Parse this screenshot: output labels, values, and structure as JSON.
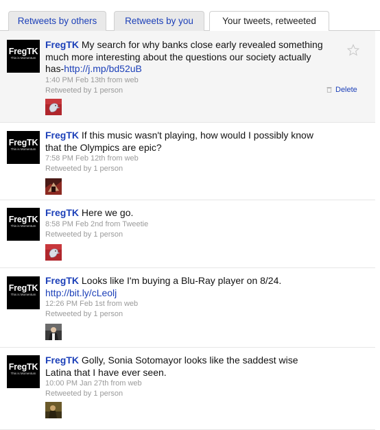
{
  "tabs": [
    {
      "label": "Retweets by others",
      "active": false
    },
    {
      "label": "Retweets by you",
      "active": false
    },
    {
      "label": "Your tweets, retweeted",
      "active": true
    }
  ],
  "avatar_logo": "FregTK",
  "avatar_tagline": "This is Momentum",
  "tweets": [
    {
      "user": "FregTK",
      "text": "My search for why banks close early revealed something much more interesting about the questions our society actually has-",
      "link": "http://j.mp/bd52uB",
      "time": "1:40 PM Feb 13th",
      "from": "from web",
      "retweeted_by": "Retweeted by 1 person",
      "delete_label": "Delete",
      "retweeter_avatar": "gray-bird-icon"
    },
    {
      "user": "FregTK",
      "text": "If this music wasn't playing, how would I possibly know that the Olympics are epic?",
      "link": "",
      "time": "7:58 PM Feb 12th",
      "from": "from web",
      "retweeted_by": "Retweeted by 1 person",
      "retweeter_avatar": "red-photo-avatar"
    },
    {
      "user": "FregTK",
      "text": "Here we go.",
      "link": "",
      "time": "8:58 PM Feb 2nd",
      "from": "from Tweetie",
      "retweeted_by": "Retweeted by 1 person",
      "retweeter_avatar": "gray-bird-icon"
    },
    {
      "user": "FregTK",
      "text": "Looks like I'm buying a Blu-Ray player on 8/24.",
      "link": "http://bit.ly/cLeolj",
      "time": "12:26 PM Feb 1st",
      "from": "from web",
      "retweeted_by": "Retweeted by 1 person",
      "retweeter_avatar": "person-photo-avatar"
    },
    {
      "user": "FregTK",
      "text": "Golly, Sonia Sotomayor looks like the saddest wise Latina that I have ever seen.",
      "link": "",
      "time": "10:00 PM Jan 27th",
      "from": "from web",
      "retweeted_by": "Retweeted by 1 person",
      "retweeter_avatar": "dark-photo-avatar"
    }
  ],
  "colors": {
    "link": "#1b3fb8",
    "meta": "#9a9a9a",
    "highlight_row": "#f5f5f5"
  }
}
